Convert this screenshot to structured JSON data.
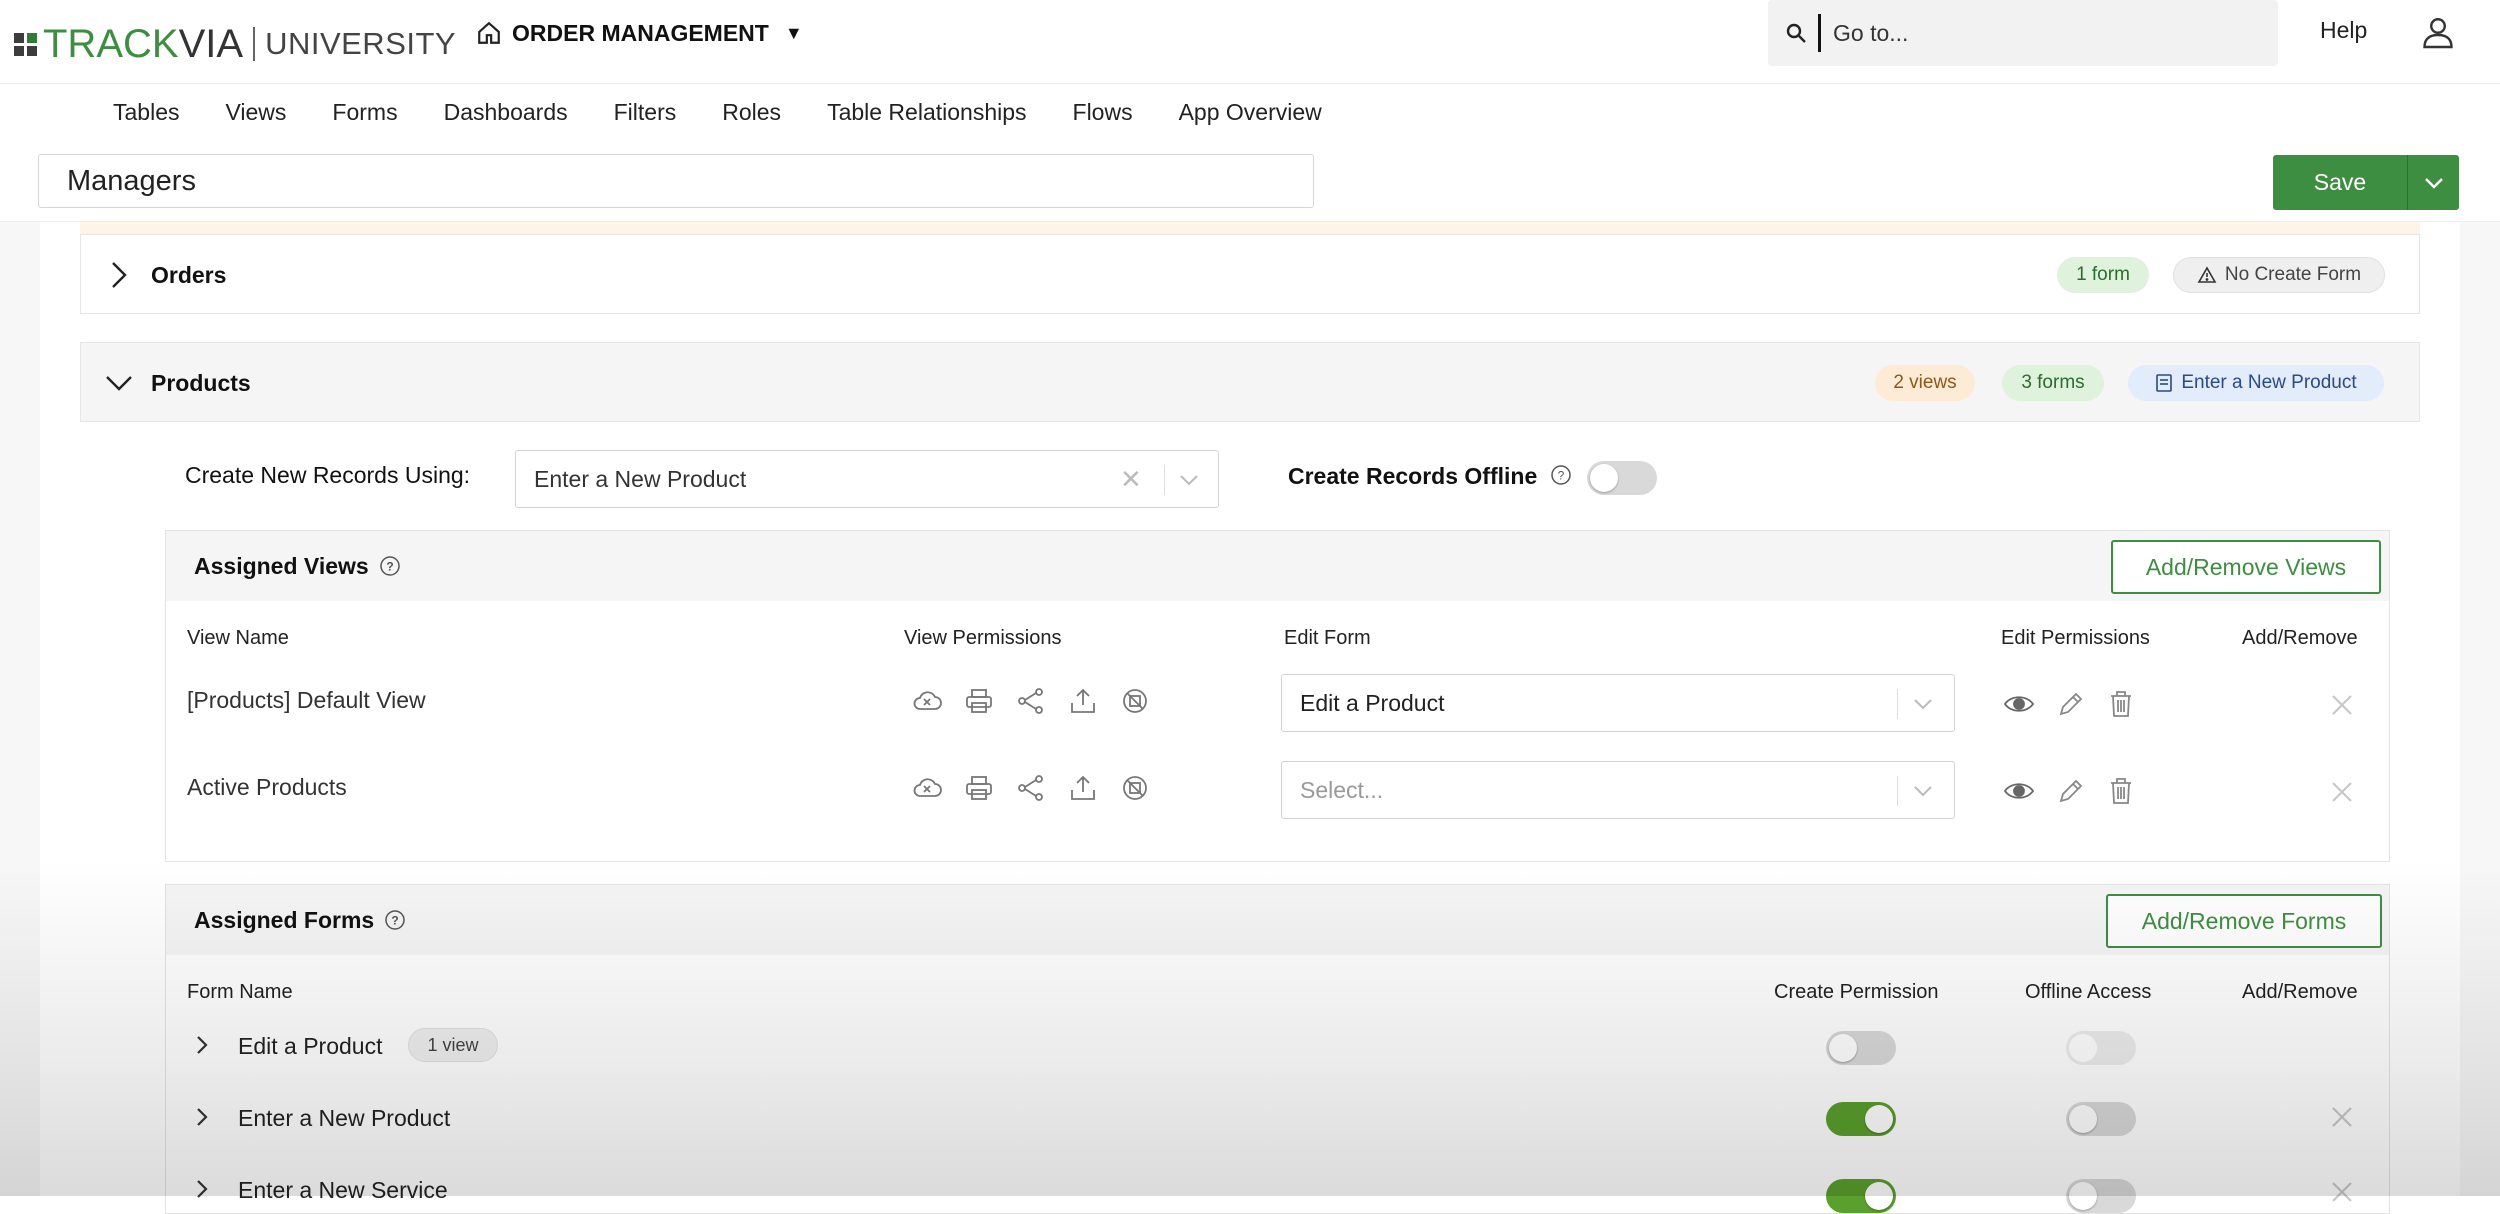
{
  "header": {
    "logo_track": "TRACK",
    "logo_via": "VIA",
    "logo_university": "UNIVERSITY",
    "app_title": "ORDER MANAGEMENT",
    "search_placeholder": "Go to...",
    "help_label": "Help"
  },
  "nav": {
    "items": [
      "Tables",
      "Views",
      "Forms",
      "Dashboards",
      "Filters",
      "Roles",
      "Table Relationships",
      "Flows",
      "App Overview"
    ]
  },
  "role": {
    "name": "Managers",
    "save_label": "Save"
  },
  "sections": {
    "orders": {
      "title": "Orders",
      "forms_badge": "1 form",
      "create_form_badge": "No Create Form"
    },
    "products": {
      "title": "Products",
      "views_badge": "2 views",
      "forms_badge": "3 forms",
      "create_form_badge": "Enter a New Product",
      "create_records_label": "Create New Records Using:",
      "create_records_value": "Enter a New Product",
      "offline_label": "Create Records Offline",
      "offline_enabled": false
    }
  },
  "assigned_views": {
    "title": "Assigned Views",
    "add_remove_label": "Add/Remove Views",
    "columns": {
      "view_name": "View Name",
      "view_permissions": "View Permissions",
      "edit_form": "Edit Form",
      "edit_permissions": "Edit Permissions",
      "add_remove": "Add/Remove"
    },
    "rows": [
      {
        "name": "[Products] Default View",
        "edit_form": "Edit a Product",
        "edit_form_is_placeholder": false
      },
      {
        "name": "Active Products",
        "edit_form": "Select...",
        "edit_form_is_placeholder": true
      }
    ]
  },
  "assigned_forms": {
    "title": "Assigned Forms",
    "add_remove_label": "Add/Remove Forms",
    "columns": {
      "form_name": "Form Name",
      "create_permission": "Create Permission",
      "offline_access": "Offline Access",
      "add_remove": "Add/Remove"
    },
    "rows": [
      {
        "name": "Edit a Product",
        "badge": "1 view",
        "create_permission": false,
        "offline_access": false
      },
      {
        "name": "Enter a New Product",
        "badge": "",
        "create_permission": true,
        "offline_access": false
      },
      {
        "name": "Enter a New Service",
        "badge": "",
        "create_permission": true,
        "offline_access": false
      }
    ]
  },
  "colors": {
    "brand_green": "#3e8e41",
    "toggle_on": "#5aa02c"
  }
}
